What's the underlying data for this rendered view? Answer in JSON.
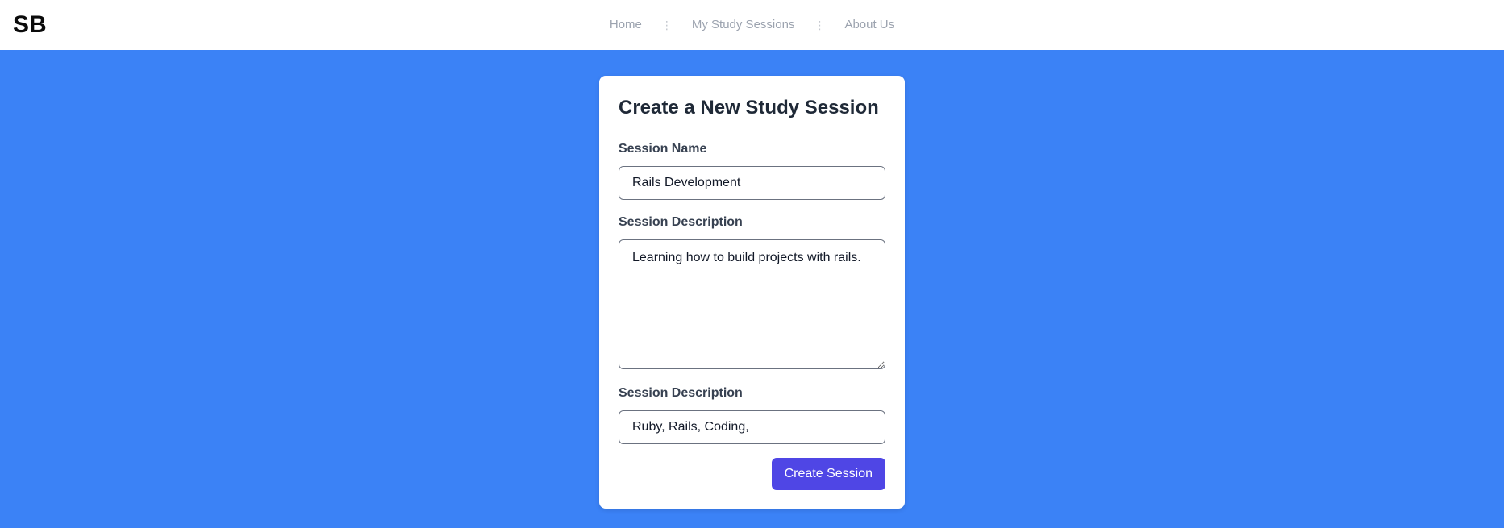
{
  "header": {
    "logo": "SB",
    "nav": [
      {
        "label": "Home"
      },
      {
        "label": "My Study Sessions"
      },
      {
        "label": "About Us"
      }
    ],
    "separator": "⋮"
  },
  "form": {
    "title": "Create a New Study Session",
    "name_label": "Session Name",
    "name_value": "Rails Development",
    "description_label": "Session Description",
    "description_value": "Learning how to build projects with rails.",
    "tags_label": "Session Description",
    "tags_value": "Ruby, Rails, Coding,",
    "submit_label": "Create Session"
  },
  "colors": {
    "background": "#3b82f6",
    "button": "#4f46e5",
    "nav_text": "#9ca3af"
  }
}
